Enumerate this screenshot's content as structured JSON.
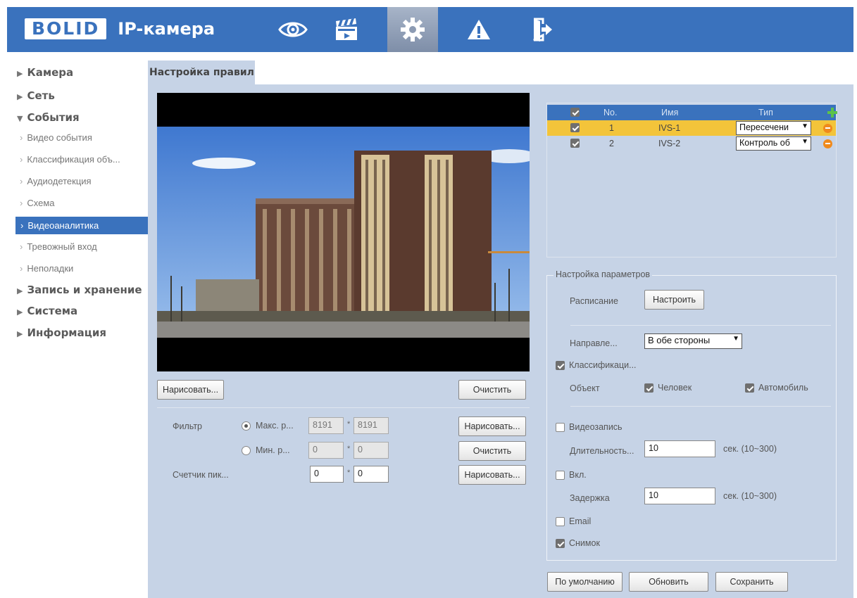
{
  "header": {
    "logo_mark": "BOLID",
    "logo_text": "IP-камера",
    "nav_icons": [
      "eye-icon",
      "clapperboard-icon",
      "gear-icon",
      "warning-icon",
      "exit-icon"
    ],
    "accent_color": "#3a72bd"
  },
  "sidebar": {
    "menu": [
      {
        "label": "Камера",
        "expanded": false
      },
      {
        "label": "Сеть",
        "expanded": false
      },
      {
        "label": "События",
        "expanded": true
      },
      {
        "label": "Запись и хранение",
        "expanded": false
      },
      {
        "label": "Система",
        "expanded": false
      },
      {
        "label": "Информация",
        "expanded": false
      }
    ],
    "events_items": [
      {
        "label": "Видео события"
      },
      {
        "label": "Классификация объ..."
      },
      {
        "label": "Аудиодетекция"
      },
      {
        "label": "Схема"
      },
      {
        "label": "Видеоаналитика"
      },
      {
        "label": "Тревожный вход"
      },
      {
        "label": "Неполадки"
      }
    ],
    "active_item": "Видеоаналитика"
  },
  "main": {
    "tab": "Настройка правил",
    "draw_button": "Нарисовать...",
    "clear_button": "Очистить",
    "filter": {
      "label": "Фильтр",
      "max_label": "Макс. р...",
      "max_w": "8191",
      "max_h": "8191",
      "min_label": "Мин. р...",
      "min_w": "0",
      "min_h": "0",
      "draw1": "Нарисовать...",
      "clear": "Очистить",
      "draw2": "Нарисовать...",
      "selected": "max"
    },
    "pixel_counter": {
      "label": "Счетчик пик...",
      "w": "0",
      "h": "0"
    },
    "star": "*"
  },
  "rules_table": {
    "headers": {
      "no": "No.",
      "name": "Имя",
      "type": "Тип"
    },
    "rows": [
      {
        "checked": true,
        "no": "1",
        "name": "IVS-1",
        "type": "Пересечени",
        "selected": true
      },
      {
        "checked": true,
        "no": "2",
        "name": "IVS-2",
        "type": "Контроль об",
        "selected": false
      }
    ]
  },
  "params": {
    "legend": "Настройка параметров",
    "schedule_label": "Расписание",
    "schedule_button": "Настроить",
    "direction_label": "Направле...",
    "direction_value": "В обе стороны",
    "classification_label": "Классификаци...",
    "classification_checked": true,
    "object_label": "Объект",
    "human_label": "Человек",
    "human_checked": true,
    "vehicle_label": "Автомобиль",
    "vehicle_checked": true,
    "record_label": "Видеозапись",
    "record_checked": false,
    "duration_label": "Длительность...",
    "duration_value": "10",
    "duration_hint": "сек. (10~300)",
    "enable_label": "Вкл.",
    "enable_checked": false,
    "delay_label": "Задержка",
    "delay_value": "10",
    "delay_hint": "сек. (10~300)",
    "email_label": "Email",
    "email_checked": false,
    "snapshot_label": "Снимок",
    "snapshot_checked": true
  },
  "footer_buttons": {
    "default": "По умолчанию",
    "refresh": "Обновить",
    "save": "Сохранить"
  }
}
